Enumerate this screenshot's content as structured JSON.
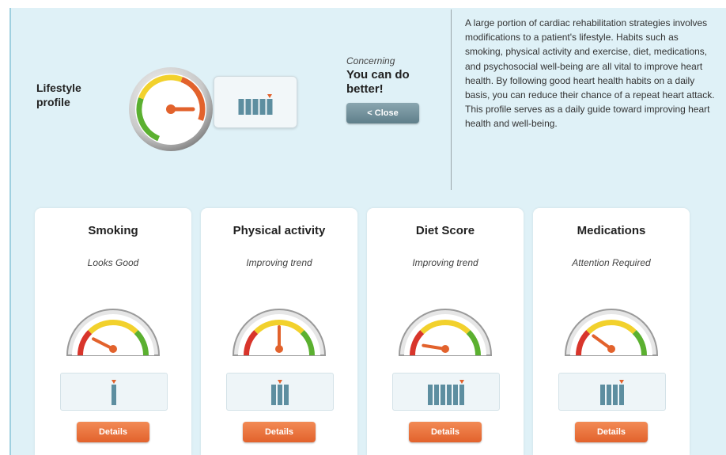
{
  "profile": {
    "title": "Lifestyle profile",
    "status_label": "Concerning",
    "status_message": "You can do better!",
    "close_label": "< Close",
    "bars": 5,
    "marker_bar": 5
  },
  "description": "A large portion of cardiac rehabilitation strategies involves modifications to a patient's lifestyle. Habits such as smoking, physical activity and exercise, diet, medications, and psychosocial well-being are all vital to improve heart health. By following good heart health habits on a daily basis, you can reduce their chance of a repeat heart attack. This profile serves as a daily guide toward improving heart health and well-being.",
  "cards": [
    {
      "title": "Smoking",
      "status": "Looks Good",
      "button": "Details",
      "bars": 1,
      "marker_bar": 1,
      "gauge_level": 0.15
    },
    {
      "title": "Physical activity",
      "status": "Improving trend",
      "button": "Details",
      "bars": 3,
      "marker_bar": 2,
      "gauge_level": 0.5
    },
    {
      "title": "Diet Score",
      "status": "Improving trend",
      "button": "Details",
      "bars": 6,
      "marker_bar": 6,
      "gauge_level": 0.05
    },
    {
      "title": "Medications",
      "status": "Attention Required",
      "button": "Details",
      "bars": 4,
      "marker_bar": 4,
      "gauge_level": 0.2
    }
  ],
  "colors": {
    "panel": "#dff1f7",
    "gauge_red": "#d8352b",
    "gauge_yellow": "#f2d12c",
    "gauge_green": "#5bb030",
    "needle": "#e2622c",
    "bar": "#5d8ea0",
    "details_button": "#e8672f",
    "close_button": "#6f8e99"
  }
}
